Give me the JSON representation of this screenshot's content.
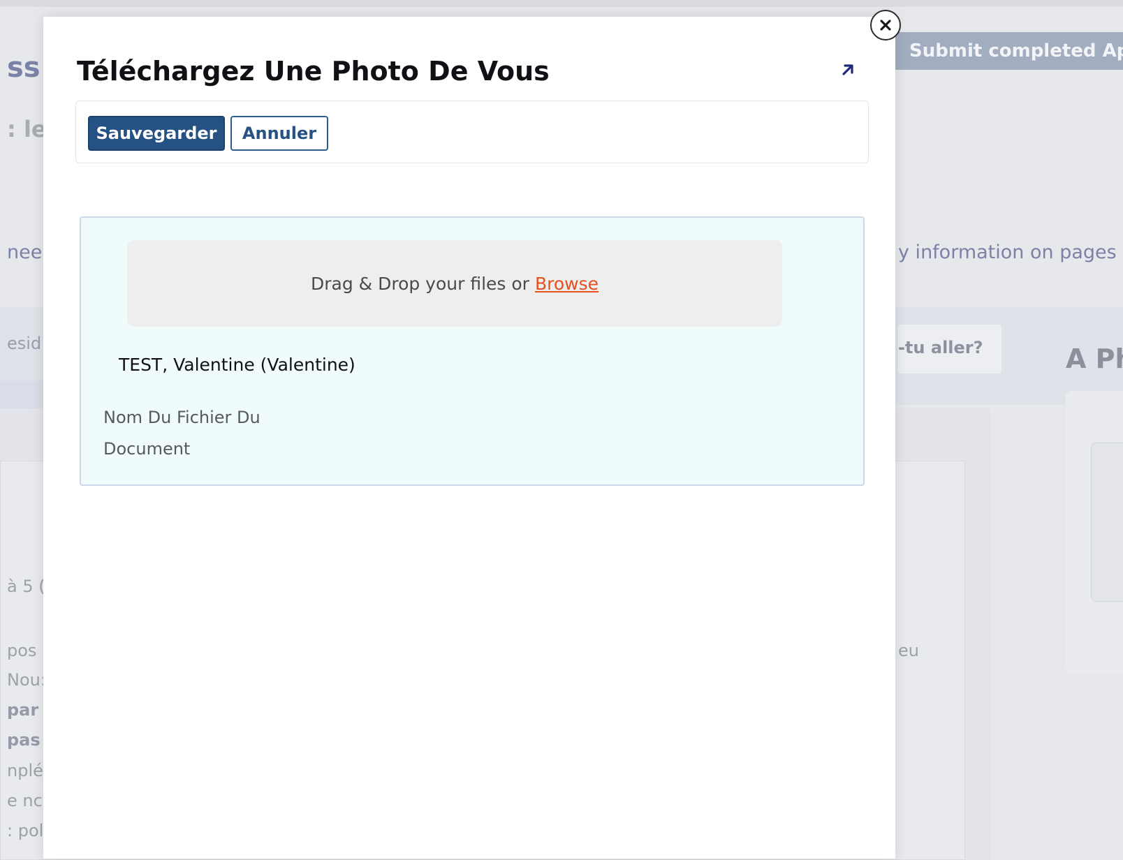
{
  "background": {
    "title_fragment": "ss",
    "subtitle_fragment": ": les",
    "notice_left_fragment": "nee",
    "notice_right_fragment": "y information on pages",
    "submit_button_label": "Submit completed App",
    "residence_fragment": "esid",
    "where_to_go_fragment": "-tu aller?",
    "photo_heading_fragment": "A Ph",
    "range_fragment": "à 5 (",
    "eu_fragment": "eu",
    "body_lines": [
      "pos",
      "Nou:",
      "par",
      "pas",
      "nplé",
      "e nc",
      ": pol"
    ]
  },
  "modal": {
    "title": "Téléchargez Une Photo De Vous",
    "expand_icon": "arrow-up-right-icon",
    "close_icon": "close-icon",
    "toolbar": {
      "save_label": "Sauvegarder",
      "cancel_label": "Annuler"
    },
    "upload": {
      "dropzone_text": "Drag & Drop your files or",
      "browse_label": "Browse",
      "person_name": "TEST, Valentine (Valentine)",
      "filename_label": "Nom Du Fichier Du Document"
    }
  },
  "colors": {
    "primary_button": "#255283",
    "browse_link": "#e8501f",
    "upload_panel_bg": "#f0fbfc",
    "background_submit": "#a2aec0"
  }
}
